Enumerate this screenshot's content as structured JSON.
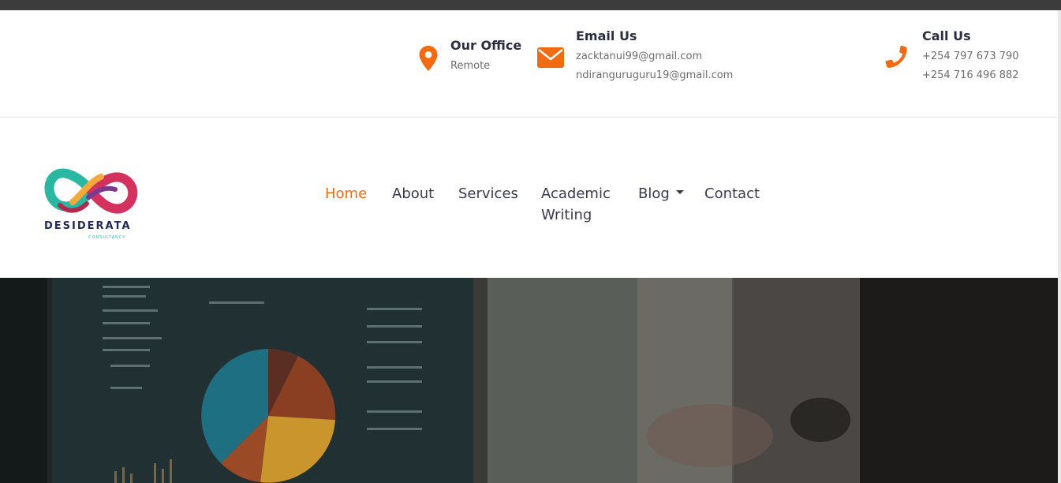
{
  "contact": {
    "office": {
      "title": "Our Office",
      "value": "Remote",
      "icon": "map-pin-icon"
    },
    "email": {
      "title": "Email Us",
      "values": [
        "zacktanui99@gmail.com",
        "ndiranguruguru19@gmail.com"
      ],
      "icon": "envelope-icon"
    },
    "phone": {
      "title": "Call Us",
      "values": [
        "+254 797 673 790",
        "+254 716 496 882"
      ],
      "icon": "phone-icon"
    }
  },
  "brand": {
    "name": "DESIDERATA",
    "tagline": "CONSULTANCY"
  },
  "nav": {
    "items": [
      {
        "label": "Home",
        "active": true
      },
      {
        "label": "About"
      },
      {
        "label": "Services"
      },
      {
        "label": "Academic Writing"
      },
      {
        "label": "Blog",
        "dropdown": true
      },
      {
        "label": "Contact"
      }
    ]
  },
  "colors": {
    "accent": "#f26b12",
    "heading": "#2b2d42",
    "text": "#6c6c6c",
    "brand_navy": "#1e2a5a"
  }
}
